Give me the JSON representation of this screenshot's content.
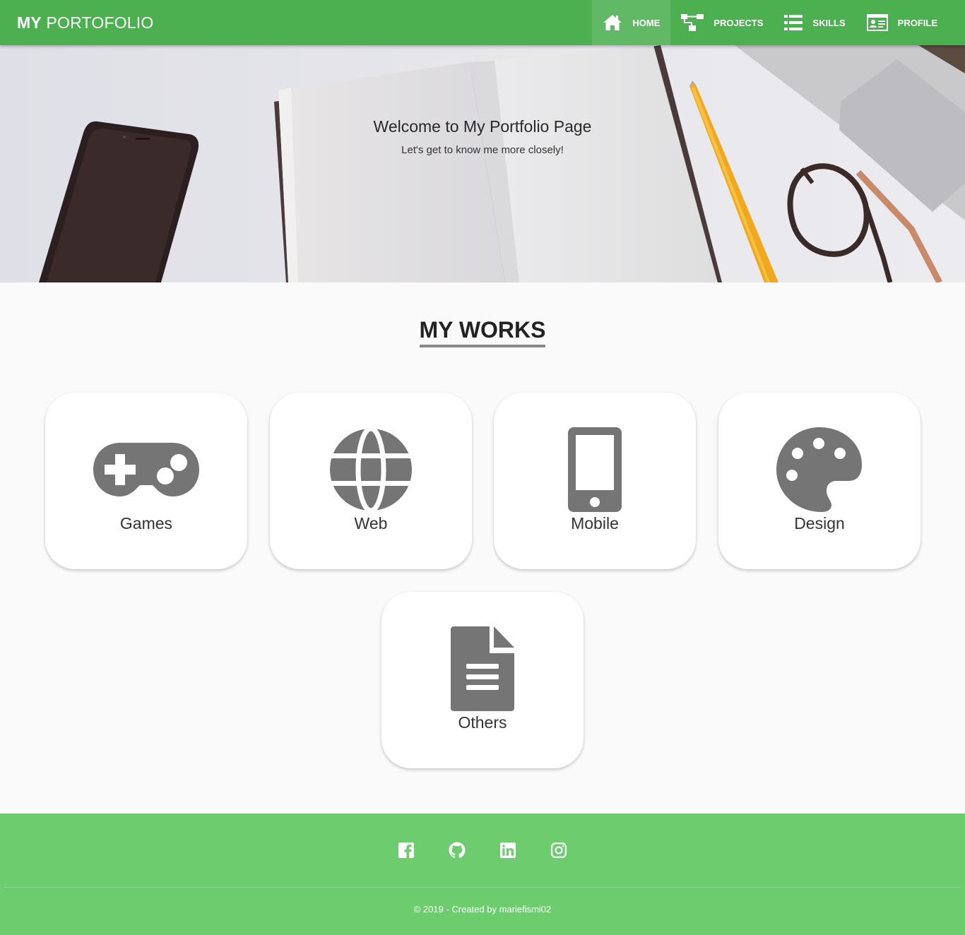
{
  "navbar": {
    "brand_bold": "MY",
    "brand_light": "PORTOFOLIO",
    "items": [
      {
        "label": "HOME",
        "icon": "home-icon",
        "active": true
      },
      {
        "label": "PROJECTS",
        "icon": "sitemap-icon",
        "active": false
      },
      {
        "label": "SKILLS",
        "icon": "list-icon",
        "active": false
      },
      {
        "label": "PROFILE",
        "icon": "id-card-icon",
        "active": false
      }
    ]
  },
  "hero": {
    "title": "Welcome to My Portfolio Page",
    "subtitle": "Let's get to know me more closely!"
  },
  "works": {
    "title": "MY WORKS",
    "cards": [
      {
        "label": "Games",
        "icon": "gamepad-icon"
      },
      {
        "label": "Web",
        "icon": "globe-icon"
      },
      {
        "label": "Mobile",
        "icon": "mobile-phone-icon"
      },
      {
        "label": "Design",
        "icon": "palette-icon"
      },
      {
        "label": "Others",
        "icon": "document-icon"
      }
    ]
  },
  "footer": {
    "socials": [
      {
        "icon": "facebook-icon"
      },
      {
        "icon": "github-icon"
      },
      {
        "icon": "linkedin-icon"
      },
      {
        "icon": "instagram-icon"
      }
    ],
    "copyright": "© 2019 - Created by mariefismi02"
  },
  "colors": {
    "primary": "#4caf50",
    "footer": "#6ccc6e",
    "icon": "#757575",
    "background": "#fafafa"
  }
}
